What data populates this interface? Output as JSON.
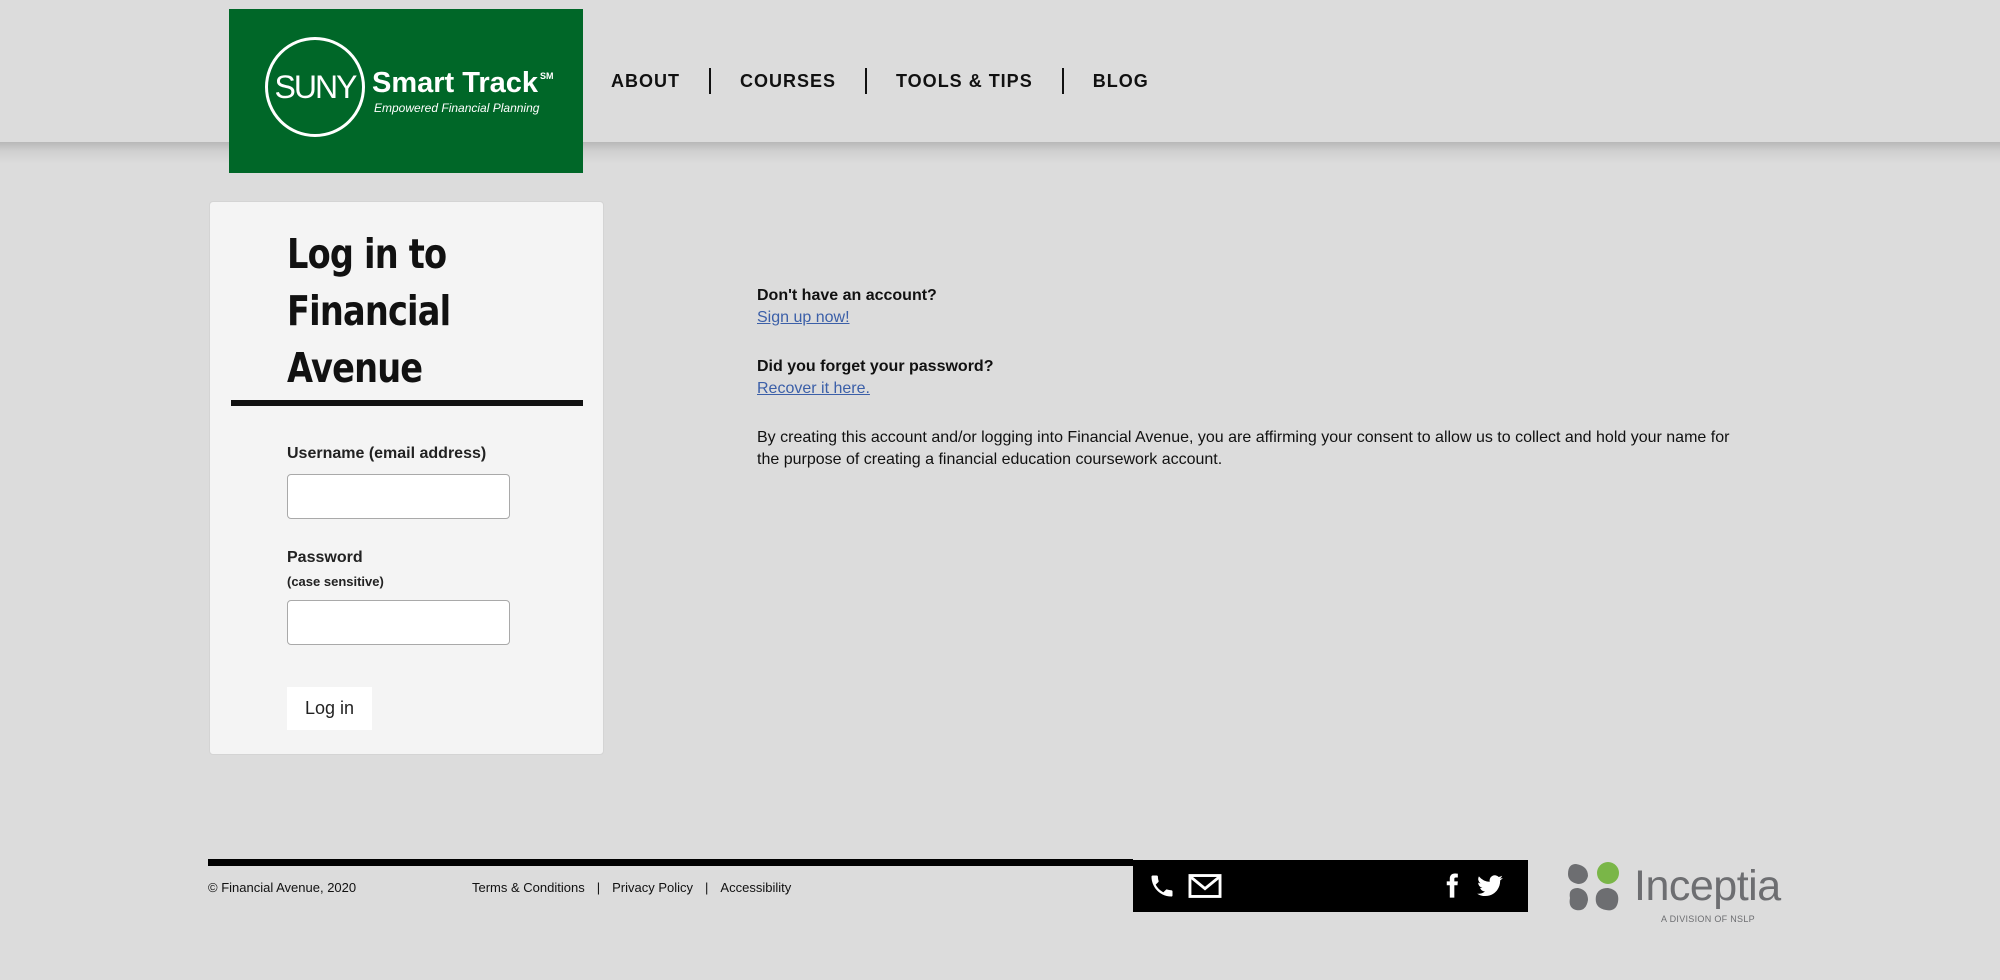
{
  "brand": {
    "mark": "SUNY",
    "name": "Smart Track",
    "trademark": "SM",
    "tagline": "Empowered Financial Planning"
  },
  "nav": {
    "items": [
      {
        "label": "ABOUT"
      },
      {
        "label": "COURSES"
      },
      {
        "label": "TOOLS & TIPS"
      },
      {
        "label": "BLOG"
      }
    ]
  },
  "login": {
    "title_line1": "Log in to",
    "title_line2": "Financial",
    "title_line3": "Avenue",
    "username_label": "Username (email address)",
    "username_value": "",
    "password_label": "Password",
    "password_note": "(case sensitive)",
    "password_value": "",
    "submit_label": "Log in"
  },
  "info": {
    "no_account_q": "Don't have an account?",
    "signup_link": "Sign up now!",
    "forgot_q": "Did you forget your password?",
    "recover_link": "Recover it here.",
    "consent_text": "By creating this account and/or logging into Financial Avenue, you are affirming your consent to allow us to collect and hold your name for the purpose of creating a financial education coursework account."
  },
  "footer": {
    "copyright": "© Financial Avenue, 2020",
    "links": [
      {
        "label": "Terms & Conditions"
      },
      {
        "label": "Privacy Policy"
      },
      {
        "label": "Accessibility"
      }
    ],
    "separator": "|",
    "contact_icons": [
      "phone-icon",
      "envelope-icon",
      "facebook-icon",
      "twitter-icon"
    ],
    "partner_name": "Inceptia",
    "partner_sub": "A DIVISION OF NSLP"
  },
  "colors": {
    "brand_green": "#006728",
    "link_blue": "#3b5fa8",
    "background": "#dcdcdc",
    "inceptia_gray": "#6d6e71",
    "inceptia_green": "#7ab648"
  }
}
